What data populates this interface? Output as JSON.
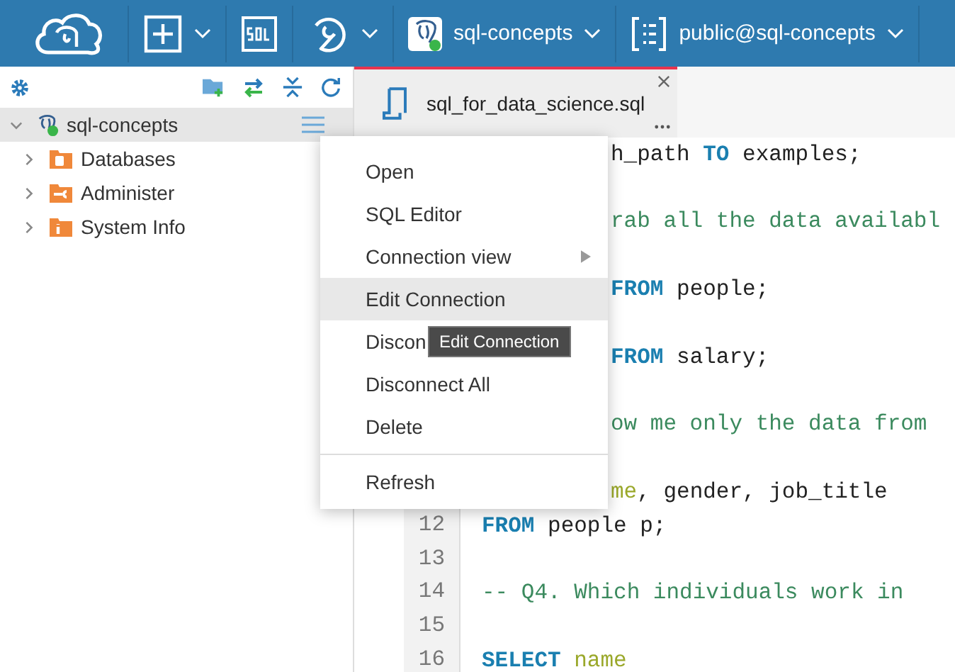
{
  "toolbar": {
    "connection": {
      "label": "sql-concepts",
      "connected": true
    },
    "schema": {
      "label": "public@sql-concepts"
    }
  },
  "sidebar": {
    "tree": [
      {
        "label": "sql-concepts",
        "expanded": true,
        "connected": true,
        "selected": true,
        "children": [
          {
            "label": "Databases",
            "kind": "databases",
            "expanded": false
          },
          {
            "label": "Administer",
            "kind": "administer",
            "expanded": false
          },
          {
            "label": "System Info",
            "kind": "info",
            "expanded": false
          }
        ]
      }
    ]
  },
  "tabs": [
    {
      "label": "sql_for_data_science.sql",
      "selected": true
    }
  ],
  "editor": {
    "lines": [
      {
        "kind": "code",
        "tokens": [
          {
            "kind": "plain",
            "text": "h_path "
          },
          {
            "kind": "keyword",
            "text": "TO"
          },
          {
            "kind": "plain",
            "text": " examples;"
          }
        ]
      },
      {
        "kind": "blank"
      },
      {
        "kind": "code",
        "tokens": [
          {
            "kind": "comment",
            "text": "rab all the data availabl"
          }
        ]
      },
      {
        "kind": "blank"
      },
      {
        "kind": "code",
        "tokens": [
          {
            "kind": "keyword",
            "text": "FROM"
          },
          {
            "kind": "plain",
            "text": " people;"
          }
        ]
      },
      {
        "kind": "blank"
      },
      {
        "kind": "code",
        "tokens": [
          {
            "kind": "keyword",
            "text": "FROM"
          },
          {
            "kind": "plain",
            "text": " salary;"
          }
        ]
      },
      {
        "kind": "blank"
      },
      {
        "kind": "code",
        "tokens": [
          {
            "kind": "comment",
            "text": "ow me only the data from"
          }
        ]
      },
      {
        "kind": "blank"
      },
      {
        "kind": "code",
        "tokens": [
          {
            "kind": "identifier",
            "text": "me"
          },
          {
            "kind": "plain",
            "text": ", gender, job_title"
          }
        ]
      },
      {
        "number": "12",
        "kind": "code",
        "tokens": [
          {
            "kind": "keyword",
            "text": "FROM"
          },
          {
            "kind": "plain",
            "text": " people p;"
          }
        ]
      },
      {
        "number": "13",
        "kind": "blank"
      },
      {
        "number": "14",
        "kind": "code",
        "tokens": [
          {
            "kind": "comment",
            "text": "-- Q4. Which individuals work in"
          }
        ]
      },
      {
        "number": "15",
        "kind": "blank"
      },
      {
        "number": "16",
        "kind": "code",
        "tokens": [
          {
            "kind": "keyword",
            "text": "SELECT"
          },
          {
            "kind": "identifier",
            "text": " name"
          }
        ]
      }
    ]
  },
  "context_menu": {
    "items": [
      {
        "kind": "item",
        "label": "Open",
        "selected": false,
        "submenu": false
      },
      {
        "kind": "item",
        "label": "SQL Editor",
        "selected": false,
        "submenu": false
      },
      {
        "kind": "item",
        "label": "Connection view",
        "selected": false,
        "submenu": true
      },
      {
        "kind": "item",
        "label": "Edit Connection",
        "selected": true,
        "submenu": false
      },
      {
        "kind": "item",
        "label": "Discon",
        "selected": false,
        "submenu": false
      },
      {
        "kind": "item",
        "label": "Disconnect All",
        "selected": false,
        "submenu": false
      },
      {
        "kind": "item",
        "label": "Delete",
        "selected": false,
        "submenu": false
      },
      {
        "kind": "separator"
      },
      {
        "kind": "item",
        "label": "Refresh",
        "selected": false,
        "submenu": false
      }
    ],
    "tooltip": "Edit Connection"
  }
}
